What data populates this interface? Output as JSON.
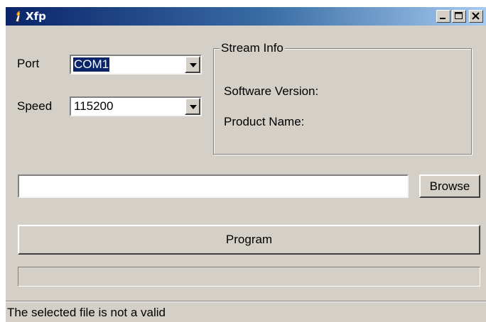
{
  "window": {
    "title": "Xfp",
    "icon": "xfp-app-icon"
  },
  "titlebar_buttons": {
    "minimize": "minimize-icon",
    "maximize": "maximize-icon",
    "close": "close-icon"
  },
  "form": {
    "port_label": "Port",
    "port_value": "COM1",
    "speed_label": "Speed",
    "speed_value": "115200"
  },
  "stream_info": {
    "title": "Stream Info",
    "software_version_label": "Software Version:",
    "product_name_label": "Product Name:"
  },
  "file": {
    "path_value": "",
    "browse_label": "Browse"
  },
  "program_label": "Program",
  "progress": {
    "fraction": 0
  },
  "status": {
    "text": "The selected file is not a valid"
  },
  "colors": {
    "face": "#d4d0c8",
    "title_start": "#0a246a",
    "title_end": "#a6caf0",
    "selection": "#0a246a"
  }
}
